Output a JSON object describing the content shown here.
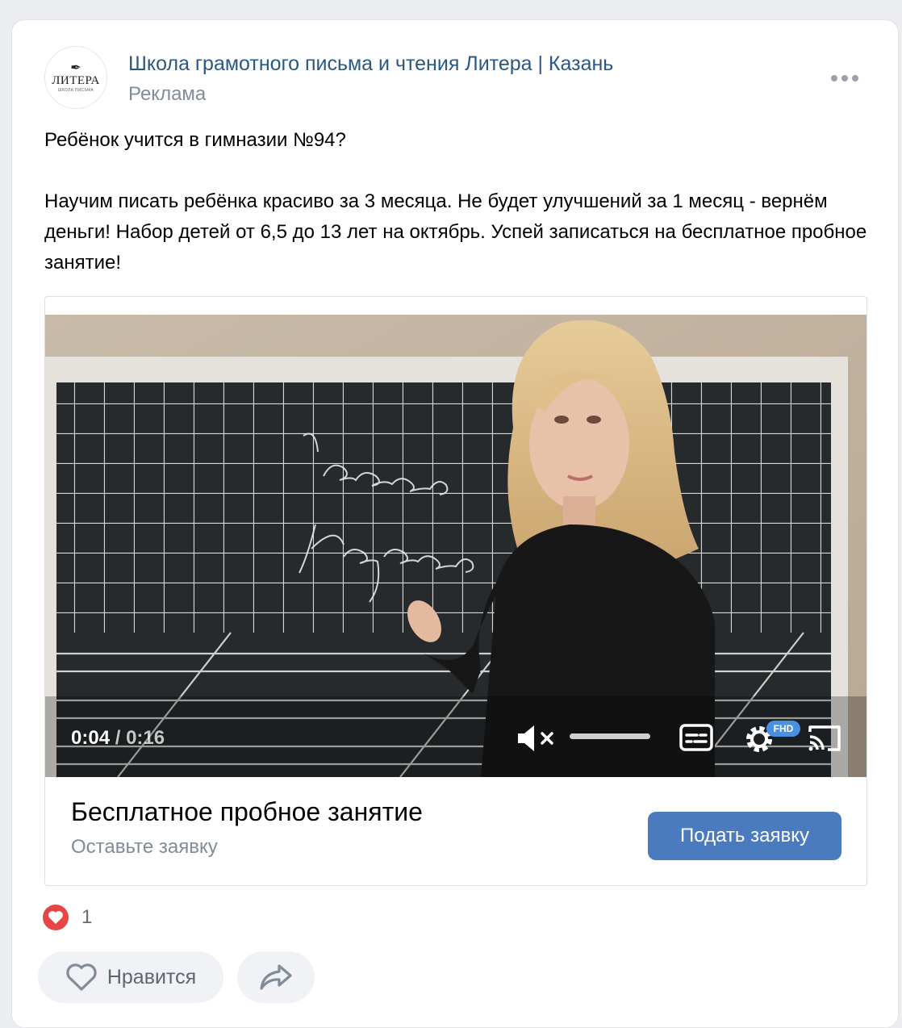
{
  "post": {
    "author": "Школа грамотного письма и чтения Литера | Казань",
    "label": "Реклама",
    "avatar": {
      "brand": "ЛИТЕРА",
      "sub": "ШКОЛА ПИСЬМА"
    },
    "text_lines": [
      "Ребёнок учится в гимназии №94?",
      "Научим писать ребёнка красиво за 3 месяца. Не будет улучшений за 1 месяц - вернём деньги! Набор детей от 6,5 до 13 лет на октябрь. Успей записаться на бесплатное пробное занятие!"
    ]
  },
  "video": {
    "current_time": "0:04",
    "separator": " / ",
    "duration": "0:16",
    "quality_badge": "FHD",
    "board_words": [
      "Казань",
      "Казань"
    ]
  },
  "cta": {
    "title": "Бесплатное пробное занятие",
    "subtitle": "Оставьте заявку",
    "button": "Подать заявку",
    "button_color": "#4a7bbf"
  },
  "reactions": {
    "count": "1",
    "heart_color": "#e64646"
  },
  "actions": {
    "like_label": "Нравится"
  },
  "icons": [
    "more-icon",
    "mute-icon",
    "subtitles-icon",
    "settings-icon",
    "cast-icon",
    "heart-icon",
    "share-icon",
    "feather-icon"
  ]
}
